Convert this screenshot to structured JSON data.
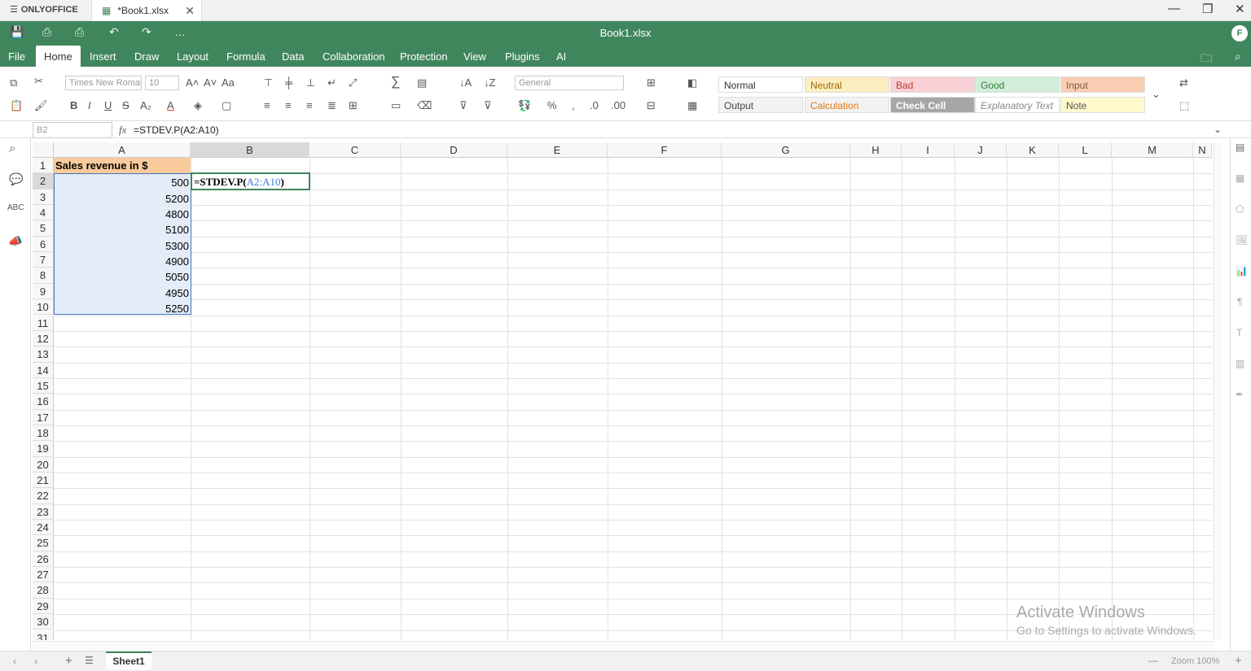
{
  "app": {
    "brand": "ONLYOFFICE",
    "tab_title": "*Book1.xlsx",
    "window_title": "Book1.xlsx",
    "avatar_letter": "F"
  },
  "menu": [
    "File",
    "Home",
    "Insert",
    "Draw",
    "Layout",
    "Formula",
    "Data",
    "Collaboration",
    "Protection",
    "View",
    "Plugins",
    "AI"
  ],
  "toolbar": {
    "font_name": "Times New Roman",
    "font_size": "10",
    "number_format": "General"
  },
  "cell_styles": {
    "row1": [
      {
        "label": "Normal",
        "bg": "#ffffff",
        "color": "#333333"
      },
      {
        "label": "Neutral",
        "bg": "#fdeec0",
        "color": "#9c6500"
      },
      {
        "label": "Bad",
        "bg": "#f8d0d5",
        "color": "#c0392b"
      },
      {
        "label": "Good",
        "bg": "#d2eed9",
        "color": "#2e7d32"
      },
      {
        "label": "Input",
        "bg": "#f9ceb2",
        "color": "#7a5a40"
      }
    ],
    "row2": [
      {
        "label": "Output",
        "bg": "#f2f2f2",
        "color": "#444444"
      },
      {
        "label": "Calculation",
        "bg": "#f2f2f2",
        "color": "#e07a10"
      },
      {
        "label": "Check Cell",
        "bg": "#a6a6a6",
        "color": "#ffffff"
      },
      {
        "label": "Explanatory Text",
        "bg": "#ffffff",
        "color": "#888888"
      },
      {
        "label": "Note",
        "bg": "#fff9cc",
        "color": "#555555"
      }
    ]
  },
  "formula_bar": {
    "name_box": "B2",
    "fx": "fx",
    "formula": "=STDEV.P(A2:A10)"
  },
  "columns": [
    "A",
    "B",
    "C",
    "D",
    "E",
    "F",
    "G",
    "H",
    "I",
    "J",
    "K",
    "L",
    "M",
    "N"
  ],
  "rows_visible": 31,
  "sheet": {
    "A1": "Sales revenue in $",
    "A_values": [
      "500",
      "5200",
      "4800",
      "5100",
      "5300",
      "4900",
      "5050",
      "4950",
      "5250"
    ],
    "B2_prefix": "=STDEV.P(",
    "B2_ref": "A2:A10",
    "B2_suffix": ")"
  },
  "colors": {
    "brand_green": "#40865c",
    "header_fill": "#f9cb9c",
    "range_fill": "#e4ecf7",
    "ref_blue": "#3d7ed6"
  },
  "bottom": {
    "sheet_tab": "Sheet1",
    "zoom": "Zoom 100%"
  },
  "watermark": {
    "line1": "Activate Windows",
    "line2": "Go to Settings to activate Windows."
  }
}
